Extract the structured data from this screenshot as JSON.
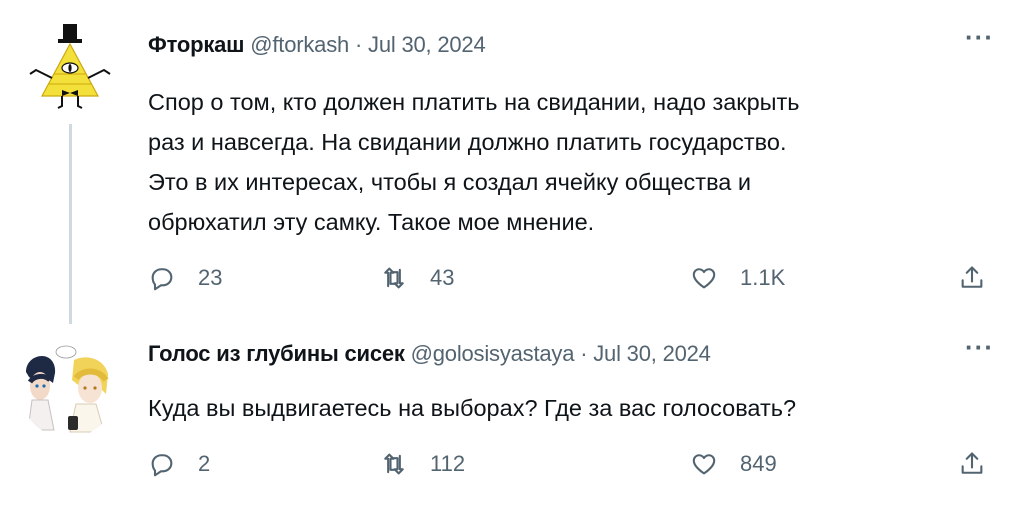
{
  "tweets": [
    {
      "name": "Фторкаш",
      "handle": "@ftorkash",
      "separator": "·",
      "date": "Jul 30, 2024",
      "more": "···",
      "text_lines": [
        "Спор о том, кто должен платить на свидании, надо закрыть",
        "раз и навсегда. На свидании должно платить государство.",
        "Это в их интересах, чтобы я создал ячейку общества и",
        "обрюхатил эту самку. Такое мое мнение."
      ],
      "replies": "23",
      "retweets": "43",
      "likes": "1.1K",
      "avatar_icon": "triangle-character-avatar-icon"
    },
    {
      "name": "Голос из глубины сисек",
      "handle": "@golosisyastaya",
      "separator": "·",
      "date": "Jul 30, 2024",
      "more": "···",
      "text_lines": [
        "Куда вы выдвигаетесь на выборах? Где за вас голосовать?"
      ],
      "replies": "2",
      "retweets": "112",
      "likes": "849",
      "avatar_icon": "anime-characters-avatar-icon"
    }
  ],
  "colors": {
    "text": "#0f1419",
    "secondary": "#536471",
    "thread_line": "#cfd9de",
    "avatar_yellow": "#f4e03a"
  },
  "icons": [
    "reply-icon",
    "retweet-icon",
    "like-icon",
    "share-icon",
    "more-icon"
  ]
}
